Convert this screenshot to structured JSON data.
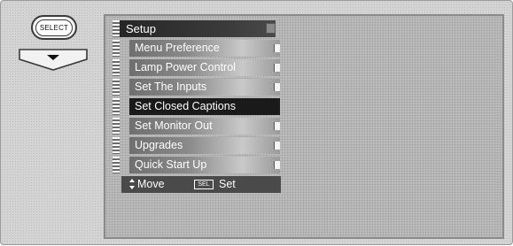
{
  "remote": {
    "select_label": "SELECT"
  },
  "menu": {
    "title": "Setup",
    "items": [
      {
        "label": "Menu Preference",
        "selected": false
      },
      {
        "label": "Lamp Power Control",
        "selected": false
      },
      {
        "label": "Set The Inputs",
        "selected": false
      },
      {
        "label": "Set Closed Captions",
        "selected": true
      },
      {
        "label": "Set Monitor Out",
        "selected": false
      },
      {
        "label": "Upgrades",
        "selected": false
      },
      {
        "label": "Quick Start Up",
        "selected": false
      }
    ],
    "footer": {
      "move_label": "Move",
      "sel_key": "SEL",
      "set_label": "Set"
    }
  }
}
